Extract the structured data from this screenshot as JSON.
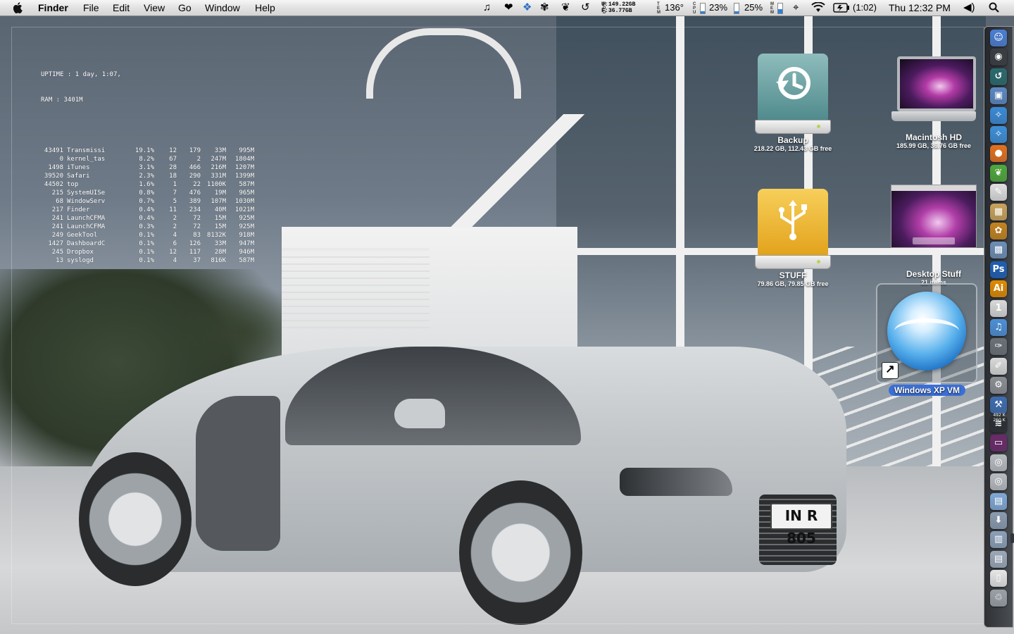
{
  "menubar": {
    "app_name": "Finder",
    "menus": [
      "File",
      "Edit",
      "View",
      "Go",
      "Window",
      "Help"
    ],
    "disk": {
      "used_label": "U:",
      "used": "149.22GB",
      "free_label": "F:",
      "free": "36.77GB"
    },
    "temperature": "136°",
    "cpu": "23%",
    "memory": "25%",
    "battery_time": "(1:02)",
    "clock": "Thu 12:32 PM",
    "icons": [
      "itunes-note-icon",
      "heart-icon",
      "dropbox-icon",
      "growl-icon",
      "evernote-icon",
      "time-machine-icon",
      "wifi-icon",
      "battery-icon",
      "volume-icon",
      "spotlight-icon"
    ]
  },
  "geektool": {
    "uptime": "UPTIME : 1 day, 1:07,",
    "ram": "RAM : 3401M",
    "processes": [
      {
        "pid": "43491",
        "name": "Transmissi",
        "cpu": "19.1%",
        "threads": "12",
        "ports": "179",
        "rsize": "33M",
        "vsize": "995M"
      },
      {
        "pid": "0",
        "name": "kernel_tas",
        "cpu": "8.2%",
        "threads": "67",
        "ports": "2",
        "rsize": "247M",
        "vsize": "1804M"
      },
      {
        "pid": "1498",
        "name": "iTunes",
        "cpu": "3.1%",
        "threads": "28",
        "ports": "466",
        "rsize": "216M",
        "vsize": "1207M"
      },
      {
        "pid": "39520",
        "name": "Safari",
        "cpu": "2.3%",
        "threads": "18",
        "ports": "290",
        "rsize": "331M",
        "vsize": "1399M"
      },
      {
        "pid": "44502",
        "name": "top",
        "cpu": "1.6%",
        "threads": "1",
        "ports": "22",
        "rsize": "1100K",
        "vsize": "587M"
      },
      {
        "pid": "215",
        "name": "SystemUISe",
        "cpu": "0.8%",
        "threads": "7",
        "ports": "476",
        "rsize": "19M",
        "vsize": "965M"
      },
      {
        "pid": "68",
        "name": "WindowServ",
        "cpu": "0.7%",
        "threads": "5",
        "ports": "389",
        "rsize": "107M",
        "vsize": "1030M"
      },
      {
        "pid": "217",
        "name": "Finder",
        "cpu": "0.4%",
        "threads": "11",
        "ports": "234",
        "rsize": "40M",
        "vsize": "1021M"
      },
      {
        "pid": "241",
        "name": "LaunchCFMA",
        "cpu": "0.4%",
        "threads": "2",
        "ports": "72",
        "rsize": "15M",
        "vsize": "925M"
      },
      {
        "pid": "241",
        "name": "LaunchCFMA",
        "cpu": "0.3%",
        "threads": "2",
        "ports": "72",
        "rsize": "15M",
        "vsize": "925M"
      },
      {
        "pid": "249",
        "name": "GeekTool",
        "cpu": "0.1%",
        "threads": "4",
        "ports": "83",
        "rsize": "8132K",
        "vsize": "918M"
      },
      {
        "pid": "1427",
        "name": "DashboardC",
        "cpu": "0.1%",
        "threads": "6",
        "ports": "126",
        "rsize": "33M",
        "vsize": "947M"
      },
      {
        "pid": "245",
        "name": "Dropbox",
        "cpu": "0.1%",
        "threads": "12",
        "ports": "117",
        "rsize": "28M",
        "vsize": "946M"
      },
      {
        "pid": "13",
        "name": "syslogd",
        "cpu": "0.1%",
        "threads": "4",
        "ports": "37",
        "rsize": "816K",
        "vsize": "587M"
      }
    ]
  },
  "desktop_icons": {
    "backup": {
      "name": "Backup",
      "info": "218.22 GB, 112.43 GB free",
      "icon": "time-machine-drive-icon"
    },
    "stuff": {
      "name": "STUFF",
      "info": "79.86 GB, 79.85 GB free",
      "icon": "usb-drive-icon"
    },
    "macintosh_hd": {
      "name": "Macintosh HD",
      "info": "185.99 GB, 36.76 GB free",
      "icon": "macbook-pro-icon"
    },
    "desktop_stuff": {
      "name": "Desktop Stuff",
      "info": "21 items",
      "icon": "folder-screenshot-icon"
    },
    "windows_vm": {
      "name": "Windows XP VM",
      "icon": "vmware-fusion-orb-icon",
      "selected": true
    }
  },
  "wallpaper": {
    "plate": "IN R 805"
  },
  "dock": {
    "items": [
      {
        "name": "finder",
        "glyph": "☺",
        "color": "#4a7fd3"
      },
      {
        "name": "dashboard",
        "glyph": "◉",
        "color": "#3a3d42"
      },
      {
        "name": "time-machine",
        "glyph": "↺",
        "color": "#2a6a6e"
      },
      {
        "name": "preview",
        "glyph": "▣",
        "color": "#5b88c2"
      },
      {
        "name": "safari",
        "glyph": "✧",
        "color": "#3a8ad6"
      },
      {
        "name": "safari-2",
        "glyph": "✧",
        "color": "#3d8fd9"
      },
      {
        "name": "firefox",
        "glyph": "●",
        "color": "#e3711f"
      },
      {
        "name": "evernote",
        "glyph": "❦",
        "color": "#4fa83c"
      },
      {
        "name": "textedit",
        "glyph": "✎",
        "color": "#e0e0e0"
      },
      {
        "name": "archive",
        "glyph": "▦",
        "color": "#c9a35a"
      },
      {
        "name": "photo-app",
        "glyph": "✿",
        "color": "#c4831e"
      },
      {
        "name": "iphoto",
        "glyph": "▩",
        "color": "#6d8fb6"
      },
      {
        "name": "photoshop",
        "glyph": "Ps",
        "color": "#1e5fb3"
      },
      {
        "name": "illustrator",
        "glyph": "Ai",
        "color": "#e08a00"
      },
      {
        "name": "ical",
        "glyph": "1",
        "color": "#d9d9d9"
      },
      {
        "name": "itunes",
        "glyph": "♫",
        "color": "#4c8fd6"
      },
      {
        "name": "script-editor",
        "glyph": "✑",
        "color": "#6b7078"
      },
      {
        "name": "notes",
        "glyph": "✐",
        "color": "#d9d9d9"
      },
      {
        "name": "system-preferences",
        "glyph": "⚙",
        "color": "#8b8f94"
      },
      {
        "name": "xcode",
        "glyph": "⚒",
        "color": "#3d6db0"
      },
      {
        "name": "network-monitor",
        "glyph": "≋",
        "color": "#2a2d31"
      },
      {
        "name": "front-row",
        "glyph": "▭",
        "color": "#6a2a6a"
      },
      {
        "name": "disk-utility",
        "glyph": "◎",
        "color": "#b8bcc0"
      },
      {
        "name": "disk-utility-2",
        "glyph": "◎",
        "color": "#b8bcc0"
      },
      {
        "name": "folder-applications",
        "glyph": "▤",
        "color": "#7fa8d6"
      },
      {
        "name": "folder-downloads",
        "glyph": "⬇",
        "color": "#8a9bb0"
      },
      {
        "name": "folder-documents",
        "glyph": "▥",
        "color": "#8aa0b8"
      },
      {
        "name": "folder-stacks",
        "glyph": "▤",
        "color": "#9aa8b8"
      },
      {
        "name": "document",
        "glyph": "▯",
        "color": "#e6e6e6"
      },
      {
        "name": "trash",
        "glyph": "♲",
        "color": "#9aa0a6"
      }
    ],
    "network_readout": [
      "492 K",
      "260 K"
    ]
  }
}
